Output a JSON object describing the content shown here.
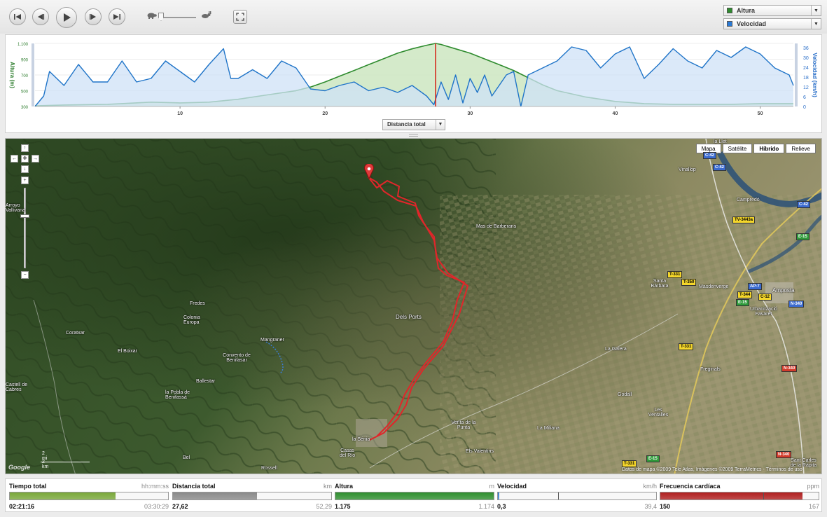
{
  "playback": {
    "buttons": [
      "go-to-start",
      "step-back",
      "play",
      "step-forward",
      "go-to-end"
    ],
    "speed_level": 0.1
  },
  "series_selects": [
    {
      "label": "Altura",
      "color": "#2e8b2e"
    },
    {
      "label": "Velocidad",
      "color": "#2a7ad6"
    }
  ],
  "chart_data": {
    "type": "area",
    "x_ticks": [
      10,
      20,
      30,
      40,
      50
    ],
    "xlim": [
      0,
      52.29
    ],
    "left_axis": {
      "label": "Altura (m)",
      "ticks": [
        "1.100",
        "900",
        "700",
        "500",
        "300"
      ],
      "ylim": [
        300,
        1175
      ],
      "color": "#2e7d2e"
    },
    "right_axis": {
      "label": "Velocidad (km/h)",
      "ticks": [
        "36",
        "30",
        "24",
        "18",
        "12",
        "6",
        "0"
      ],
      "ylim": [
        0,
        36
      ],
      "color": "#2a6fc9"
    },
    "cursor_x": 27.62,
    "series": [
      {
        "name": "Altura",
        "color": "#2e8b2e",
        "fill": "#cfe8c4",
        "axis": "left",
        "x": [
          0,
          2,
          5,
          8,
          10,
          12,
          14,
          16,
          18,
          19,
          20,
          21,
          22,
          23,
          24,
          25,
          26,
          27,
          27.62,
          28,
          29,
          30,
          31,
          32,
          33,
          34,
          35,
          36,
          38,
          40,
          42,
          44,
          46,
          48,
          50,
          52.29
        ],
        "y": [
          310,
          320,
          330,
          360,
          350,
          360,
          400,
          460,
          520,
          570,
          640,
          720,
          800,
          880,
          960,
          1040,
          1100,
          1150,
          1175,
          1160,
          1100,
          1040,
          960,
          880,
          800,
          700,
          600,
          520,
          430,
          370,
          340,
          330,
          330,
          330,
          340,
          340
        ]
      },
      {
        "name": "Velocidad",
        "color": "#1f74c8",
        "fill": "#cfe2f7",
        "axis": "right",
        "x": [
          0,
          0.6,
          1,
          2,
          3,
          4,
          5,
          6,
          7,
          8,
          9,
          10,
          11,
          12,
          13,
          13.5,
          14,
          15,
          16,
          17,
          18,
          19,
          20,
          21,
          22,
          23,
          24,
          25,
          26,
          27,
          27.5,
          28,
          28.5,
          29,
          29.5,
          30,
          30.5,
          31,
          31.5,
          32,
          32.5,
          33,
          33.5,
          34,
          35,
          36,
          37,
          38,
          39,
          40,
          41,
          42,
          43,
          44,
          45,
          46,
          47,
          48,
          49,
          50,
          51,
          52,
          52.29
        ],
        "y": [
          0,
          6,
          20,
          12,
          24,
          14,
          14,
          26,
          14,
          16,
          26,
          20,
          14,
          24,
          33,
          16,
          16,
          21,
          16,
          26,
          22,
          10,
          9,
          12,
          14,
          9,
          11,
          8,
          12,
          6,
          1,
          14,
          4,
          18,
          2,
          16,
          8,
          18,
          6,
          12,
          18,
          20,
          0,
          18,
          22,
          26,
          34,
          32,
          22,
          30,
          34,
          16,
          24,
          33,
          26,
          22,
          32,
          28,
          34,
          30,
          22,
          18,
          12
        ]
      }
    ]
  },
  "distance_select": {
    "label": "Distancia total"
  },
  "map": {
    "types": [
      "Mapa",
      "Satélite",
      "Híbrido",
      "Relieve"
    ],
    "active_type": "Híbrido",
    "places": [
      "Mas de Barberans",
      "Dels Ports",
      "Fredes",
      "Colonia Europa",
      "Coratxar",
      "El Boixar",
      "Convento de Benifasar",
      "Mangraner",
      "Ballestar",
      "la Pobla de Benifassà",
      "Castell de Cabres",
      "Arroyo Vallivana",
      "la Sénia",
      "Casas del Río",
      "Rossell",
      "Bel",
      "Venta de la Punta",
      "Els Valentins",
      "La Miliana",
      "La Galera",
      "Godall",
      "Les Ventalles",
      "Freginals",
      "Santa Bàrbara",
      "Masdenverge",
      "Amposta",
      "Urbanització Favaret",
      "Vinallop",
      "Campredó",
      "la Llet",
      "Sant Carles de la Ràpita"
    ],
    "roads": [
      "C-42",
      "C-42",
      "C-42",
      "TV-3443a",
      "E-15",
      "T-331",
      "T-350",
      "T-344",
      "E-15",
      "AP-7",
      "C-12",
      "N-340",
      "T-331",
      "N-340",
      "E-15",
      "N-340",
      "T-331"
    ],
    "scale": [
      "2 mi",
      "2 km"
    ],
    "copyright": "Datos de mapa ©2009 Tele Atlas, Imágenes ©2009 TerraMetrics - Términos de uso"
  },
  "stats": [
    {
      "label": "Tiempo total",
      "unit": "hh:mm:ss",
      "current": "02:21:16",
      "max": "03:30:29",
      "fraction": 0.67,
      "color": "#7aa83a"
    },
    {
      "label": "Distancia total",
      "unit": "km",
      "current": "27,62",
      "max": "52,29",
      "fraction": 0.53,
      "color": "#8a8a8a"
    },
    {
      "label": "Altura",
      "unit": "m",
      "current": "1.175",
      "max": "1.174",
      "fraction": 1.0,
      "color": "#2f8f2f"
    },
    {
      "label": "Velocidad",
      "unit": "km/h",
      "current": "0,3",
      "max": "39,4",
      "fraction": 0.01,
      "color": "#3a7fd0",
      "marker": 0.38
    },
    {
      "label": "Frecuencia cardíaca",
      "unit": "ppm",
      "current": "150",
      "max": "167",
      "fraction": 0.9,
      "color": "#b01f1f",
      "marker": 0.65
    }
  ]
}
